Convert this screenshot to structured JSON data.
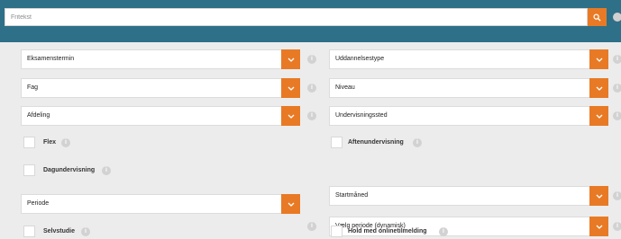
{
  "search": {
    "placeholder": "Fritekst",
    "icon": "search-icon",
    "accent": "#e87a25",
    "bar_color": "#2e7087"
  },
  "dropdowns": {
    "eksamenstermin": "Eksamenstermin",
    "fag": "Fag",
    "afdeling": "Afdeling",
    "periode": "Periode",
    "uddannelsestype": "Uddannelsestype",
    "niveau": "Niveau",
    "undervisningssted": "Undervisningssted",
    "startmaaned": "Startmåned",
    "vaelg_periode": "Vælg periode (dynamisk)"
  },
  "checkboxes": {
    "flex": "Flex",
    "dagundervisning": "Dagundervisning",
    "selvstudie": "Selvstudie",
    "aftenundervisning": "Aftenundervisning",
    "hold_med_onlinetilmelding": "Hold med onlinetilmelding"
  },
  "info_icon": "info-icon",
  "chevron_icon": "chevron-down-icon"
}
